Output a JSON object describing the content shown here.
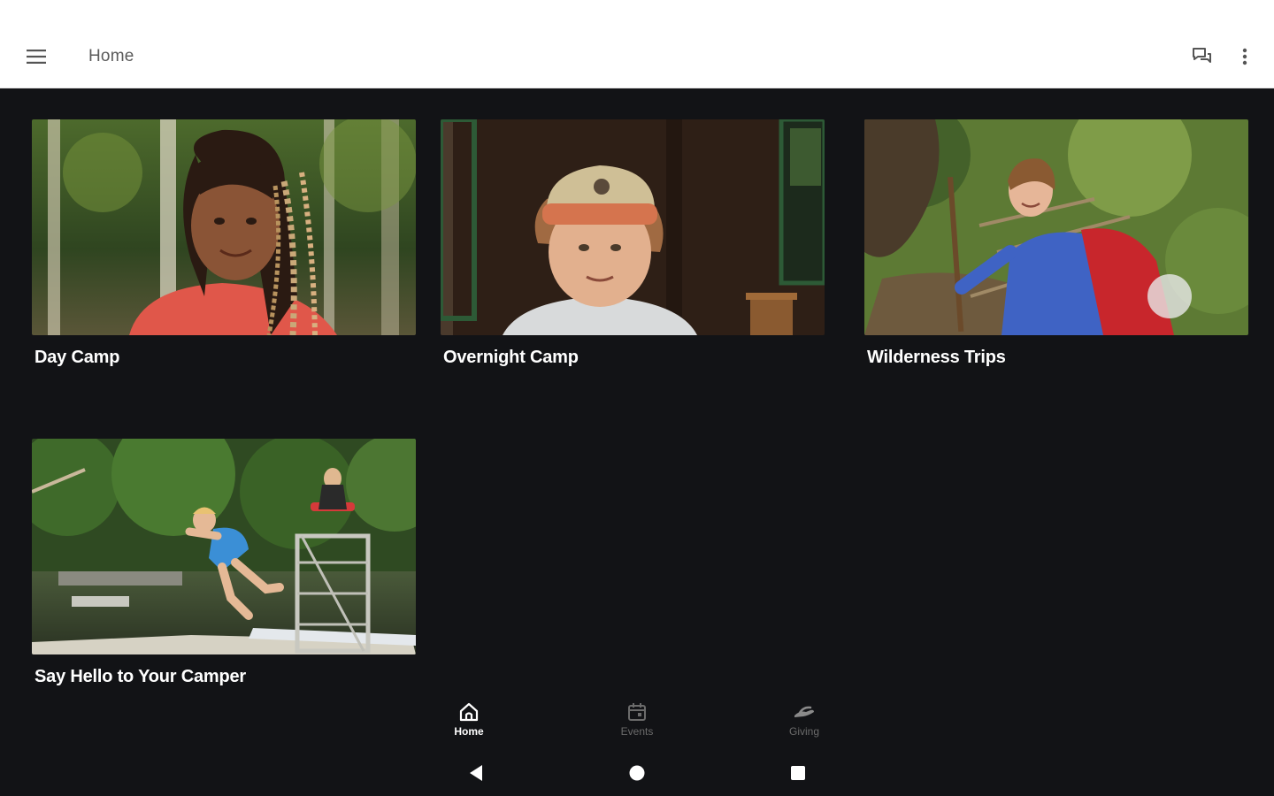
{
  "appbar": {
    "title": "Home",
    "menu_icon": "hamburger-menu-icon",
    "chat_icon": "chat-bubbles-icon",
    "more_icon": "more-vertical-icon",
    "background": "#ffffff"
  },
  "content": {
    "background": "#121316",
    "cards": [
      {
        "label": "Day Camp",
        "image": "girl-with-braids-in-forest"
      },
      {
        "label": "Overnight Camp",
        "image": "boy-in-cap-by-cabin"
      },
      {
        "label": "Wilderness Trips",
        "image": "hiker-with-red-backpack"
      },
      {
        "label": "Say Hello to Your Camper",
        "image": "boy-jumping-off-dock-into-lake"
      }
    ]
  },
  "bottom_nav": {
    "items": [
      {
        "label": "Home",
        "icon": "home-icon",
        "active": true
      },
      {
        "label": "Events",
        "icon": "calendar-icon",
        "active": false
      },
      {
        "label": "Giving",
        "icon": "giving-hand-icon",
        "active": false
      }
    ]
  },
  "system_nav": {
    "back_icon": "back-triangle-icon",
    "home_icon": "home-circle-icon",
    "recents_icon": "recents-square-icon"
  }
}
